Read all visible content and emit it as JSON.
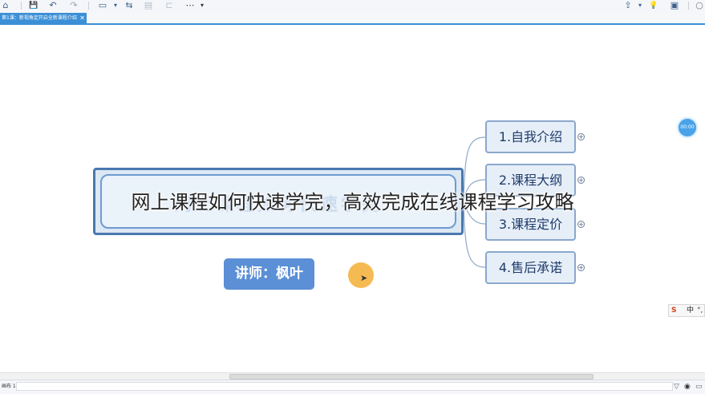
{
  "toolbar": {
    "home_icon": "⌂",
    "save_icon": "💾",
    "undo_icon": "↶",
    "redo_icon": "↷",
    "layout_icon": "▭",
    "dropdown_icon": "▾",
    "relationship_icon": "⇆",
    "boundary_icon": "▤",
    "summary_icon": "⊏",
    "more_icon": "⋯",
    "export_icon": "⇪",
    "idea_icon": "💡",
    "present_icon": "▣",
    "search_icon": "○"
  },
  "tab": {
    "label": "第1课：新视角定开启全新课程介绍",
    "close": "✕"
  },
  "mindmap": {
    "central_title": "网上课程如何快速学完",
    "branches": [
      {
        "label": "1.自我介绍"
      },
      {
        "label": "2.课程大纲"
      },
      {
        "label": "3.课程定价"
      },
      {
        "label": "4.售后承诺"
      }
    ],
    "expand_symbol": "+",
    "lecturer_label": "讲师：枫叶"
  },
  "timer": {
    "label": "00:00"
  },
  "ime": {
    "logo": "S",
    "lang": "中",
    "mode": "°,"
  },
  "overlay_caption": "网上课程如何快速学完，高效完成在线课程学习攻略",
  "statusbar": {
    "sheet_label": "画布 1",
    "filter_icon": "▽",
    "eye_icon": "◉",
    "zoom_icon": "▭"
  },
  "colors": {
    "accent": "#3b8fd6",
    "central_border": "#4a78b0",
    "branch_fill": "#e6eef8",
    "lecturer_fill": "#5b8fd6",
    "cursor_halo": "#f5b340"
  }
}
